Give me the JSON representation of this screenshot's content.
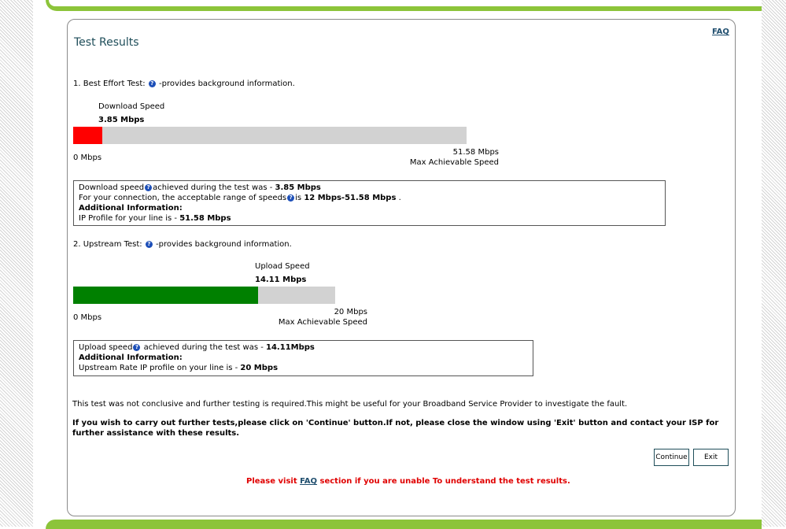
{
  "page": {
    "title": "Test Results",
    "faq_link": "FAQ"
  },
  "best_effort": {
    "heading": "1. Best Effort Test:",
    "heading_suffix": "-provides background information.",
    "speed_label": "Download Speed",
    "speed_value": "3.85 Mbps",
    "speed_fraction": 0.0746,
    "min_label": "0 Mbps",
    "max_value": "51.58 Mbps",
    "max_label": "Max Achievable Speed",
    "bar_color": "#ff0000",
    "info": {
      "line1_prefix": "Download speed",
      "line1_mid": "achieved during the test was - ",
      "line1_value": "3.85 Mbps",
      "line2_prefix": "For your connection, the acceptable range of speeds",
      "line2_mid": "is ",
      "line2_value": "12 Mbps-51.58 Mbps",
      "line2_suffix": " .",
      "line3": "Additional Information:",
      "line4_prefix": "IP Profile for your line is - ",
      "line4_value": "51.58 Mbps"
    }
  },
  "upstream": {
    "heading": "2. Upstream Test:",
    "heading_suffix": "-provides background information.",
    "speed_label": "Upload Speed",
    "speed_value": "14.11 Mbps",
    "speed_fraction": 0.7055,
    "min_label": "0 Mbps",
    "max_value": "20 Mbps",
    "max_label": "Max Achievable Speed",
    "bar_color": "#008000",
    "info": {
      "line1_prefix": "Upload speed",
      "line1_mid": " achieved during the test was - ",
      "line1_value": "14.11Mbps",
      "line2": "Additional Information:",
      "line3_prefix": "Upstream Rate IP profile on your line is - ",
      "line3_value": "20 Mbps"
    }
  },
  "messages": {
    "inconclusive": "This test was not conclusive and further testing is required.This might be useful for your Broadband Service Provider to investigate the fault.",
    "instructions": "If you wish to carry out further tests,please click on 'Continue' button.If not, please close the window using 'Exit' button and contact your ISP for further assistance with these results.",
    "notice_prefix": "Please visit ",
    "notice_link": "FAQ",
    "notice_suffix": " section if you are unable To understand the test results."
  },
  "buttons": {
    "continue": "Continue",
    "exit": "Exit"
  },
  "icons": {
    "help": "question-circle-icon"
  },
  "colors": {
    "title": "#1f4e5a",
    "accent_green": "#8cc43a",
    "notice_red": "#e00000"
  }
}
